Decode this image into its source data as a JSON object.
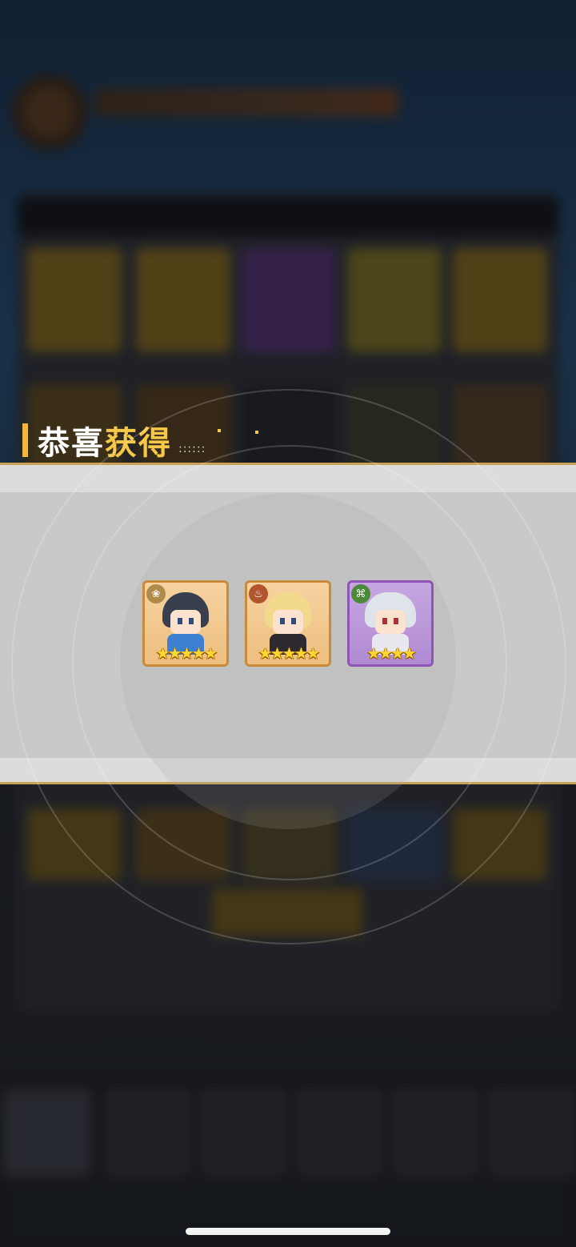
{
  "banner": {
    "title_part1": "恭喜",
    "title_highlight": "获得",
    "title_dots": "::::::"
  },
  "rewards": [
    {
      "name": "reward-hero-1",
      "icon": "lotus-faction-icon",
      "rarity": "orange",
      "stars": "★★★★★",
      "star_count": 5
    },
    {
      "name": "reward-hero-2",
      "icon": "flame-faction-icon",
      "rarity": "orange",
      "stars": "★★★★★",
      "star_count": 5
    },
    {
      "name": "reward-hero-3",
      "icon": "dna-faction-icon",
      "rarity": "purple",
      "stars": "★★★★",
      "star_count": 4
    }
  ],
  "colors": {
    "accent_gold": "#f5c84a",
    "band_border": "#c9a257",
    "orange_frame": "#c98a3a",
    "purple_frame": "#8e55b6"
  }
}
